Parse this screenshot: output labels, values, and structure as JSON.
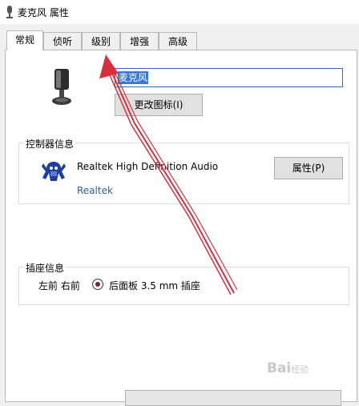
{
  "window": {
    "title": "麦克风 属性"
  },
  "tabs": [
    {
      "label": "常规",
      "active": true
    },
    {
      "label": "侦听",
      "active": false
    },
    {
      "label": "级别",
      "active": false
    },
    {
      "label": "增强",
      "active": false
    },
    {
      "label": "高级",
      "active": false
    }
  ],
  "general": {
    "device_name": "麦克风",
    "change_icon_label": "更改图标(I)"
  },
  "controller": {
    "group_label": "控制器信息",
    "name": "Realtek High Definition Audio",
    "vendor": "Realtek",
    "properties_label": "属性(P)"
  },
  "jack": {
    "group_label": "插座信息",
    "location": "左前 右前",
    "description": "后面板 3.5 mm 插座"
  },
  "watermark": {
    "brand": "Bai",
    "suffix": "经验"
  },
  "colors": {
    "accent": "#3a78d8",
    "annotation_arrow": "#d6303c"
  }
}
